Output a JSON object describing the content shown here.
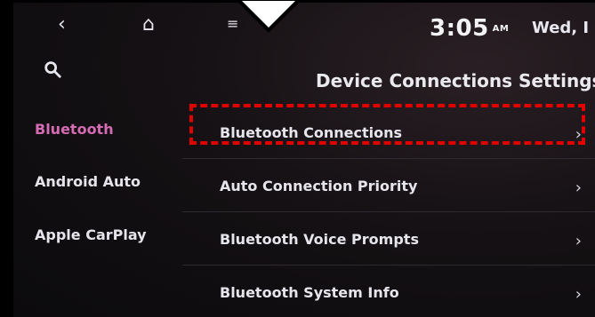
{
  "topbar": {
    "time": "3:05",
    "ampm": "AM",
    "date": "Wed, I"
  },
  "page": {
    "title": "Device Connections Settings"
  },
  "sidebar": {
    "items": [
      {
        "label": "Bluetooth",
        "active": true
      },
      {
        "label": "Android Auto",
        "active": false
      },
      {
        "label": "Apple CarPlay",
        "active": false
      }
    ]
  },
  "list": {
    "items": [
      {
        "label": "Bluetooth Connections"
      },
      {
        "label": "Auto Connection Priority"
      },
      {
        "label": "Bluetooth Voice Prompts"
      },
      {
        "label": "Bluetooth System Info"
      }
    ]
  },
  "icons": {
    "back": "back-arrow-icon",
    "home": "home-icon",
    "menu": "menu-icon",
    "search": "search-icon",
    "chevron": "chevron-right-icon"
  },
  "colors": {
    "active": "#d56bb3",
    "callout": "#e00000"
  }
}
